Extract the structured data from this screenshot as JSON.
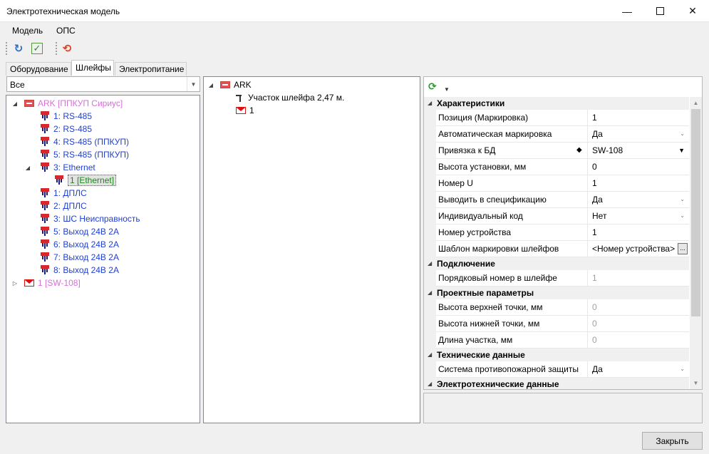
{
  "window": {
    "title": "Электротехническая модель",
    "minimize_glyph": "—",
    "close_glyph": "✕"
  },
  "menu": [
    "Модель",
    "ОПС"
  ],
  "toolbar": {
    "refresh_icon": "↻",
    "check_icon": "✓",
    "sync_icon": "⟲"
  },
  "tabs": [
    "Оборудование",
    "Шлейфы",
    "Электропитание"
  ],
  "active_tab": 1,
  "filter": {
    "value": "Все",
    "arrow": "▼"
  },
  "left_tree": [
    {
      "expander": "◢",
      "icon": "device",
      "label": "ARK [ППКУП Сириус]",
      "color": "pink"
    },
    {
      "expander": "",
      "icon": "loop",
      "label": "1: RS-485",
      "color": "blue"
    },
    {
      "expander": "",
      "icon": "loop",
      "label": "2: RS-485",
      "color": "blue"
    },
    {
      "expander": "",
      "icon": "loop",
      "label": "4: RS-485 (ППКУП)",
      "color": "blue"
    },
    {
      "expander": "",
      "icon": "loop",
      "label": "5: RS-485 (ППКУП)",
      "color": "blue"
    },
    {
      "expander": "◢",
      "icon": "loop",
      "label": "3: Ethernet",
      "color": "blue"
    },
    {
      "expander": "",
      "icon": "loop",
      "label": "1 [Ethernet]",
      "color": "selected"
    },
    {
      "expander": "",
      "icon": "loop",
      "label": "1: ДПЛС",
      "color": "blue"
    },
    {
      "expander": "",
      "icon": "loop",
      "label": "2: ДПЛС",
      "color": "blue"
    },
    {
      "expander": "",
      "icon": "loop",
      "label": "3: ШС Неисправность",
      "color": "blue"
    },
    {
      "expander": "",
      "icon": "loop",
      "label": "5: Выход 24В 2А",
      "color": "blue"
    },
    {
      "expander": "",
      "icon": "loop",
      "label": "6: Выход 24В 2А",
      "color": "blue"
    },
    {
      "expander": "",
      "icon": "loop",
      "label": "7: Выход 24В 2А",
      "color": "blue"
    },
    {
      "expander": "",
      "icon": "loop",
      "label": "8: Выход 24В 2А",
      "color": "blue"
    },
    {
      "expander": "▷",
      "icon": "envelope",
      "label": "1 [SW-108]",
      "color": "pink"
    }
  ],
  "mid_tree": [
    {
      "expander": "◢",
      "icon": "device",
      "label": "ARK"
    },
    {
      "expander": "",
      "icon": "segment",
      "label": "Участок шлейфа 2,47 м."
    },
    {
      "expander": "",
      "icon": "envelope",
      "label": "1"
    }
  ],
  "property_grid": {
    "toolbar_refresh_icon": "⟳",
    "toolbar_dropdown": "▼",
    "categories": {
      "characteristics": "Характеристики",
      "connection": "Подключение",
      "design": "Проектные параметры",
      "technical": "Технические данные",
      "electrical": "Электротехнические данные"
    },
    "rows": {
      "position": {
        "name": "Позиция (Маркировка)",
        "value": "1"
      },
      "automark": {
        "name": "Автоматическая маркировка",
        "value": "Да"
      },
      "db_link": {
        "name": "Привязка к БД",
        "value": "SW-108",
        "marker": "◆"
      },
      "install_height": {
        "name": "Высота установки, мм",
        "value": "0"
      },
      "unit_number": {
        "name": "Номер U",
        "value": "1"
      },
      "in_spec": {
        "name": "Выводить в спецификацию",
        "value": "Да"
      },
      "ind_code": {
        "name": "Индивидуальный код",
        "value": "Нет"
      },
      "device_number": {
        "name": "Номер устройства",
        "value": "1"
      },
      "loop_template": {
        "name": "Шаблон маркировки шлейфов",
        "value": "<Номер устройства>.<"
      },
      "loop_order": {
        "name": "Порядковый номер в шлейфе",
        "value": "1"
      },
      "top_height": {
        "name": "Высота верхней точки, мм",
        "value": "0"
      },
      "bottom_height": {
        "name": "Высота нижней точки, мм",
        "value": "0"
      },
      "segment_length": {
        "name": "Длина участка, мм",
        "value": "0"
      },
      "fire_protection": {
        "name": "Система противопожарной защиты",
        "value": "Да"
      }
    },
    "ellipsis": "...",
    "dropdown_glyph": "⌄",
    "dropdown_dark": "▼"
  },
  "close_button": "Закрыть"
}
